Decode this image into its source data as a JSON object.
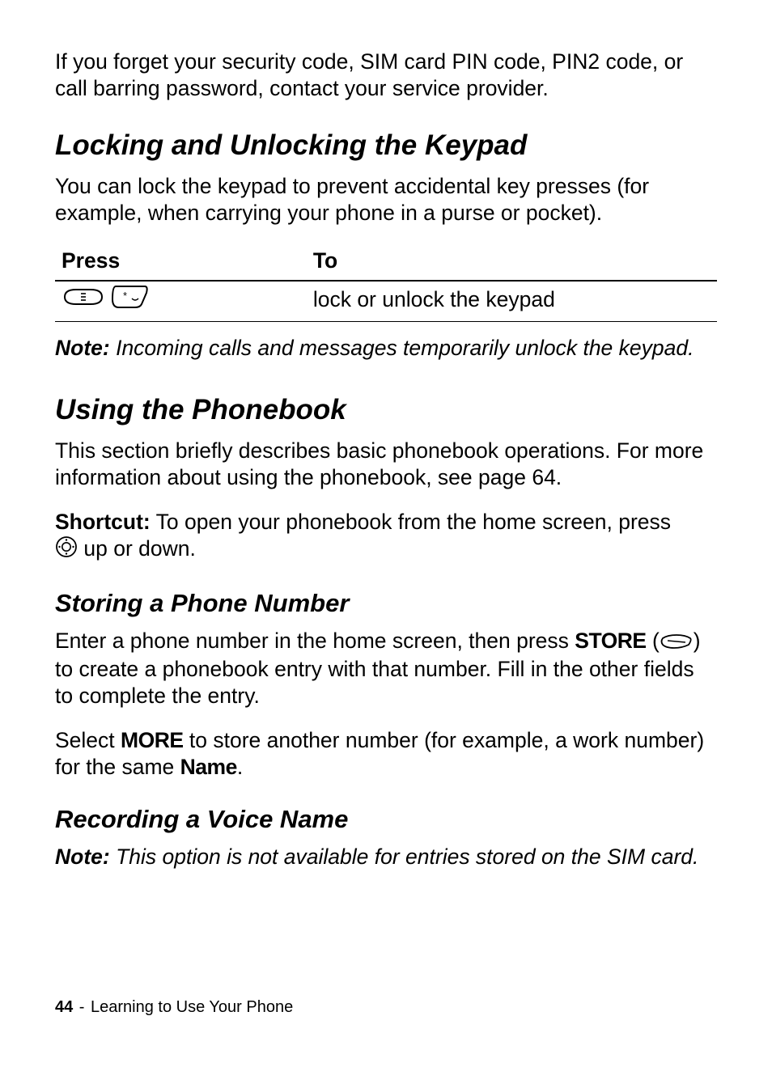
{
  "intro": "If you forget your security code, SIM card PIN code, PIN2 code, or call barring password, contact your service provider.",
  "section1": {
    "title": "Locking and Unlocking the Keypad",
    "body": "You can lock the keypad to prevent accidental key presses (for example, when carrying your phone in a purse or pocket).",
    "table": {
      "head_press": "Press",
      "head_to": "To",
      "row_to": "lock or unlock the keypad"
    },
    "note_label": "Note:",
    "note_body": " Incoming calls and messages temporarily unlock the keypad."
  },
  "section2": {
    "title": "Using the Phonebook",
    "body": "This section briefly describes basic phonebook operations. For more information about using the phonebook, see page 64.",
    "shortcut_label": "Shortcut:",
    "shortcut_pre": " To open your phonebook from the home screen, press ",
    "shortcut_post": " up or down."
  },
  "sub1": {
    "title": "Storing a Phone Number",
    "p1_pre": "Enter a phone number in the home screen, then press ",
    "store_word": "STORE",
    "p1_mid_open": " (",
    "p1_mid_close": ") to create a phonebook entry with that number. Fill in the other fields to complete the entry.",
    "p2_pre": "Select ",
    "more_word": "MORE",
    "p2_mid": " to store another number (for example, a work number) for the same ",
    "name_word": "Name",
    "p2_end": "."
  },
  "sub2": {
    "title": "Recording a Voice Name",
    "note_label": "Note:",
    "note_body": " This option is not available for entries stored on the SIM card."
  },
  "footer": {
    "page_num": "44",
    "sep": " - ",
    "chapter": "Learning to Use Your Phone"
  },
  "icons": {
    "menu_key": "menu-key-icon",
    "star_key": "star-key-icon",
    "nav_key": "nav-key-icon",
    "soft_key": "right-soft-key-icon"
  }
}
